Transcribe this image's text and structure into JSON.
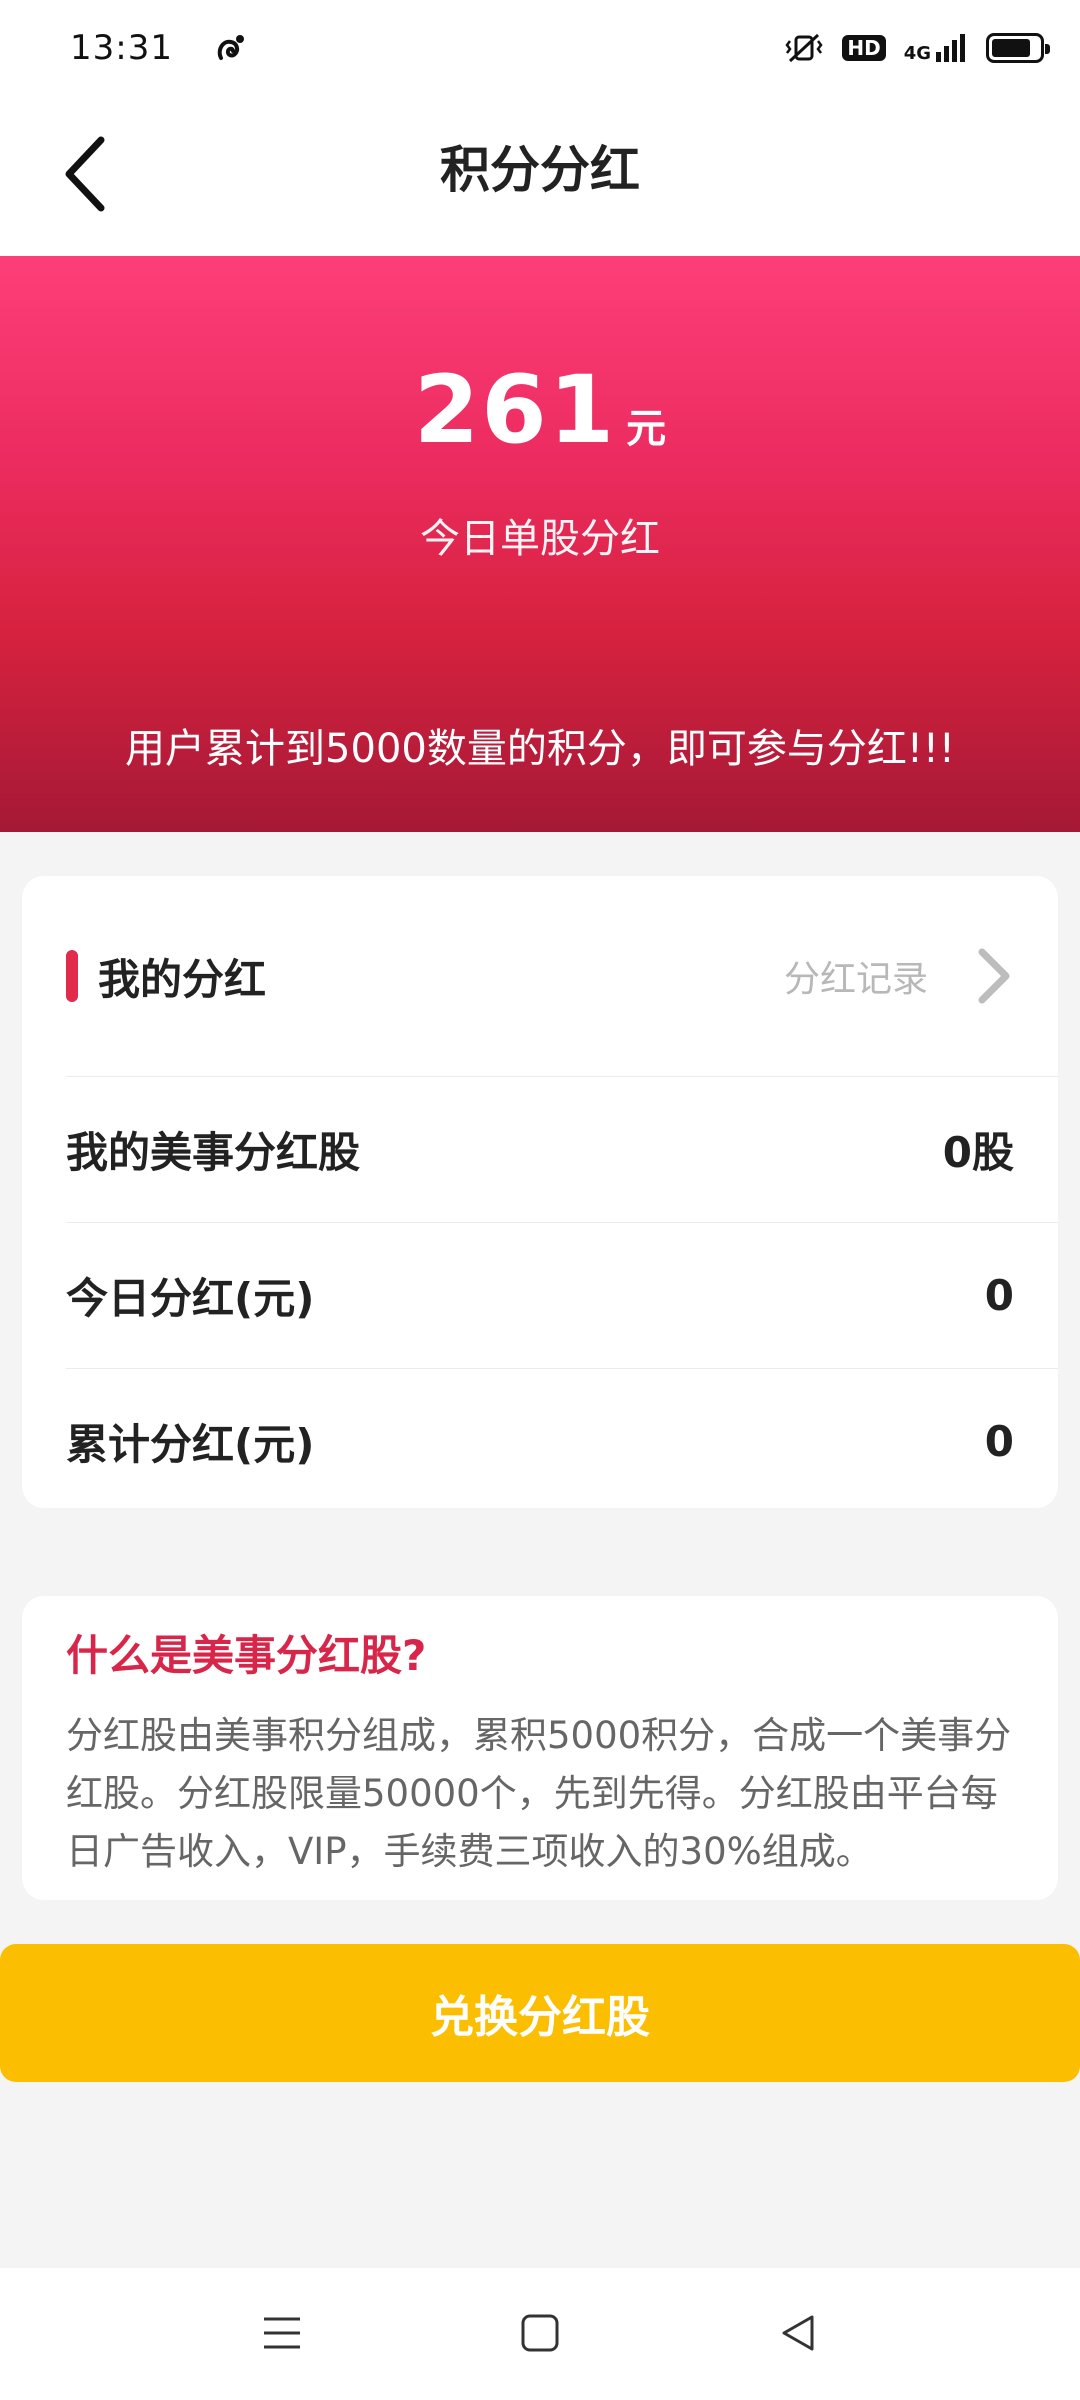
{
  "status_bar": {
    "time": "13:31",
    "hd_label": "HD",
    "network_label": "4G",
    "icons": [
      "app-notification-icon",
      "vibrate-icon",
      "hd-icon",
      "signal-icon",
      "battery-icon"
    ]
  },
  "header": {
    "title": "积分分红",
    "back_icon": "chevron-left-icon"
  },
  "hero": {
    "amount": "261",
    "unit": "元",
    "label": "今日单股分红",
    "notice": "用户累计到5000数量的积分，即可参与分红!!!",
    "colors": {
      "top": "#fd3f79",
      "bottom": "#a51936"
    }
  },
  "dividend_card": {
    "title": "我的分红",
    "record_link": "分红记录",
    "accent_color": "#e12a4c",
    "rows": [
      {
        "label": "我的美事分红股",
        "value": "0股"
      },
      {
        "label": "今日分红(元)",
        "value": "0"
      },
      {
        "label": "累计分红(元)",
        "value": "0"
      }
    ]
  },
  "info_card": {
    "title": "什么是美事分红股?",
    "body": "分红股由美事积分组成，累积5000积分，合成一个美事分红股。分红股限量50000个，先到先得。分红股由平台每日广告收入，VIP，手续费三项收入的30%组成。"
  },
  "exchange_button": {
    "label": "兑换分红股",
    "color": "#fcbe00"
  },
  "nav_bar": {
    "icons": [
      "menu-icon",
      "home-icon",
      "back-icon"
    ]
  }
}
